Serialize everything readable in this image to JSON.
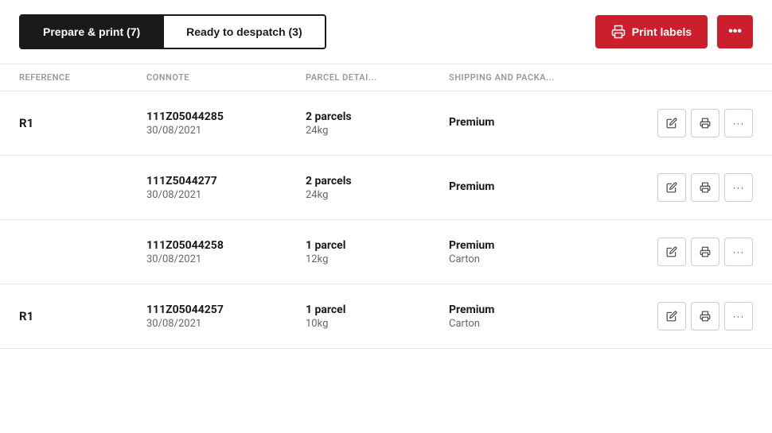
{
  "tabs": [
    {
      "id": "prepare",
      "label": "Prepare & print (7)",
      "active": true
    },
    {
      "id": "despatch",
      "label": "Ready to despatch (3)",
      "active": false
    }
  ],
  "buttons": {
    "print_labels": "Print labels",
    "more_options": "..."
  },
  "table": {
    "headers": [
      "REFERENCE",
      "CONNOTE",
      "PARCEL DETAI...",
      "SHIPPING AND PACKA...",
      ""
    ],
    "rows": [
      {
        "reference": "R1",
        "connote": "111Z05044285",
        "date": "30/08/2021",
        "parcel_count": "2 parcels",
        "parcel_weight": "24kg",
        "shipping_service": "Premium",
        "shipping_type": ""
      },
      {
        "reference": "",
        "connote": "111Z5044277",
        "date": "30/08/2021",
        "parcel_count": "2 parcels",
        "parcel_weight": "24kg",
        "shipping_service": "Premium",
        "shipping_type": ""
      },
      {
        "reference": "",
        "connote": "111Z05044258",
        "date": "30/08/2021",
        "parcel_count": "1 parcel",
        "parcel_weight": "12kg",
        "shipping_service": "Premium",
        "shipping_type": "Carton"
      },
      {
        "reference": "R1",
        "connote": "111Z05044257",
        "date": "30/08/2021",
        "parcel_count": "1 parcel",
        "parcel_weight": "10kg",
        "shipping_service": "Premium",
        "shipping_type": "Carton"
      }
    ]
  }
}
